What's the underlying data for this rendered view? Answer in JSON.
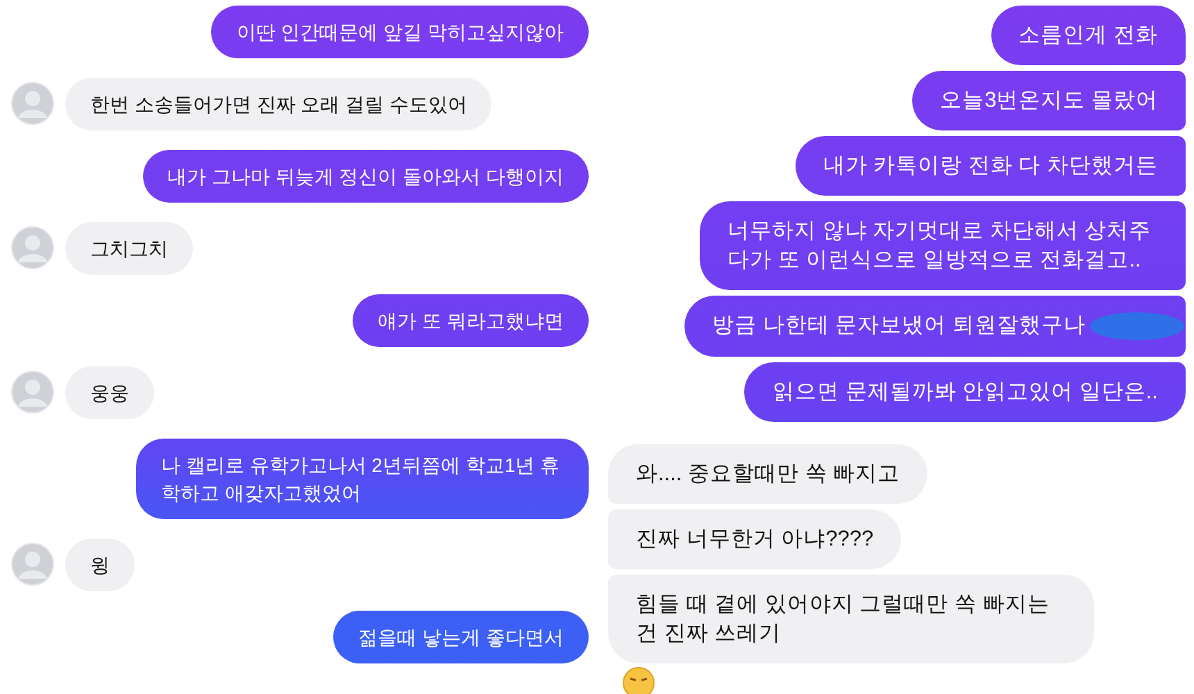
{
  "panels": [
    {
      "messages": [
        {
          "kind": "sent",
          "text": "이딴 인간때문에 앞길 막히고싶지않아"
        },
        {
          "kind": "received",
          "text": "한번 소송들어가면 진짜 오래 걸릴 수도있어",
          "avatar": true
        },
        {
          "kind": "sent",
          "text": "내가 그나마 뒤늦게 정신이 돌아와서 다행이지"
        },
        {
          "kind": "received",
          "text": "그치그치",
          "avatar": true
        },
        {
          "kind": "sent",
          "text": "얘가 또 뭐라고했냐면"
        },
        {
          "kind": "received",
          "text": "웅웅",
          "avatar": true
        },
        {
          "kind": "sent",
          "text": "나 캘리로 유학가고나서 2년뒤쯤에 학교1년 휴학하고 애갖자고했었어"
        },
        {
          "kind": "received",
          "text": "윙",
          "avatar": true
        },
        {
          "kind": "sent",
          "text": "젊을때 낳는게 좋다면서"
        }
      ]
    },
    {
      "messages": [
        {
          "kind": "sent",
          "text": "소름인게 전화"
        },
        {
          "kind": "sent",
          "text": "오늘3번온지도 몰랐어"
        },
        {
          "kind": "sent",
          "text": "내가 카톡이랑 전화 다 차단했거든"
        },
        {
          "kind": "sent",
          "text": "너무하지 않냐 자기멋대로 차단해서 상처주다가 또 이런식으로 일방적으로 전화걸고.."
        },
        {
          "kind": "sent",
          "text": "방금 나한테 문자보냈어 퇴원잘했구나",
          "redacted": true
        },
        {
          "kind": "sent",
          "text": "읽으면 문제될까봐 안읽고있어 일단은.."
        },
        {
          "kind": "received",
          "text": "와.... 중요할때만 쏙 빠지고",
          "avatar": false
        },
        {
          "kind": "received",
          "text": "진짜 너무한거 아냐????",
          "avatar": false
        },
        {
          "kind": "received",
          "text": "힘들 때 곁에 있어야지 그럴때만 쏙 빠지는건 진짜 쓰레기",
          "avatar": false,
          "reaction": true
        }
      ]
    }
  ]
}
